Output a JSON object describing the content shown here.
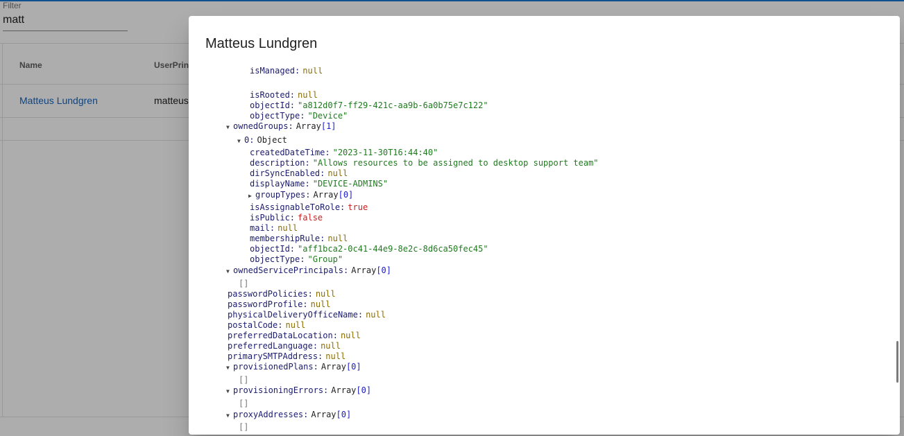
{
  "background": {
    "filter_label": "Filter",
    "filter_value": "matt",
    "table": {
      "columns": [
        "Name",
        "UserPrinc"
      ],
      "rows": [
        {
          "name": "Matteus Lundgren",
          "upn": "matteus"
        }
      ]
    }
  },
  "dialog": {
    "title": "Matteus Lundgren",
    "tree": {
      "device_tail": [
        {
          "key": "isManaged",
          "value": "null",
          "kind": "null"
        },
        {
          "key": "isRooted",
          "value": "null",
          "kind": "null"
        },
        {
          "key": "objectId",
          "value": "\"a812d0f7-ff29-421c-aa9b-6a0b75e7c122\"",
          "kind": "string"
        },
        {
          "key": "objectType",
          "value": "\"Device\"",
          "kind": "string"
        }
      ],
      "ownedGroups": {
        "key": "ownedGroups",
        "type": "Array",
        "count": "[1]"
      },
      "group0": {
        "key": "0",
        "type": "Object"
      },
      "group_fields": [
        {
          "key": "createdDateTime",
          "value": "\"2023-11-30T16:44:40\"",
          "kind": "string"
        },
        {
          "key": "description",
          "value": "\"Allows resources to be assigned to desktop support team\"",
          "kind": "string"
        },
        {
          "key": "dirSyncEnabled",
          "value": "null",
          "kind": "null"
        },
        {
          "key": "displayName",
          "value": "\"DEVICE-ADMINS\"",
          "kind": "string"
        }
      ],
      "groupTypes": {
        "key": "groupTypes",
        "type": "Array",
        "count": "[0]"
      },
      "group_fields2": [
        {
          "key": "isAssignableToRole",
          "value": "true",
          "kind": "bool"
        },
        {
          "key": "isPublic",
          "value": "false",
          "kind": "bool"
        },
        {
          "key": "mail",
          "value": "null",
          "kind": "null"
        },
        {
          "key": "membershipRule",
          "value": "null",
          "kind": "null"
        },
        {
          "key": "objectId",
          "value": "\"aff1bca2-0c41-44e9-8e2c-8d6ca50fec45\"",
          "kind": "string"
        },
        {
          "key": "objectType",
          "value": "\"Group\"",
          "kind": "string"
        }
      ],
      "ownedServicePrincipals": {
        "key": "ownedServicePrincipals",
        "type": "Array",
        "count": "[0]",
        "empty": "[]"
      },
      "top_fields": [
        {
          "key": "passwordPolicies",
          "value": "null",
          "kind": "null"
        },
        {
          "key": "passwordProfile",
          "value": "null",
          "kind": "null"
        },
        {
          "key": "physicalDeliveryOfficeName",
          "value": "null",
          "kind": "null"
        },
        {
          "key": "postalCode",
          "value": "null",
          "kind": "null"
        },
        {
          "key": "preferredDataLocation",
          "value": "null",
          "kind": "null"
        },
        {
          "key": "preferredLanguage",
          "value": "null",
          "kind": "null"
        },
        {
          "key": "primarySMTPAddress",
          "value": "null",
          "kind": "null"
        }
      ],
      "provisionedPlans": {
        "key": "provisionedPlans",
        "type": "Array",
        "count": "[0]",
        "empty": "[]"
      },
      "provisioningErrors": {
        "key": "provisioningErrors",
        "type": "Array",
        "count": "[0]",
        "empty": "[]"
      },
      "proxyAddresses": {
        "key": "proxyAddresses",
        "type": "Array",
        "count": "[0]",
        "empty": "[]"
      }
    }
  },
  "icons": {
    "expanded": "▼",
    "collapsed": "▶"
  }
}
